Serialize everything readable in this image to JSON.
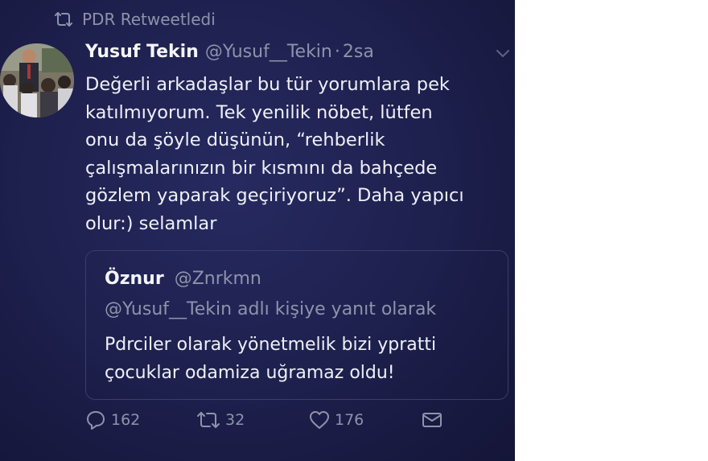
{
  "retweet_context": {
    "icon": "retweet-icon",
    "label": "PDR Retweetledi"
  },
  "author": {
    "name": "Yusuf Tekin",
    "handle": "@Yusuf__Tekin",
    "separator": "·",
    "time": "2sa",
    "avatar": "avatar-photo"
  },
  "tweet_text": "Değerli arkadaşlar bu tür yorumlara pek\nkatılmıyorum. Tek yenilik nöbet, lütfen\nonu da şöyle düşünün, “rehberlik\nçalışmalarınızın bir kısmını da bahçede\ngözlem yaparak geçiriyoruz”. Daha yapıcı\nolur:) selamlar",
  "quoted_tweet": {
    "name": "Öznur",
    "handle": "@Znrkmn",
    "reply_context": "@Yusuf__Tekin adlı kişiye yanıt olarak",
    "text": "Pdrciler olarak yönetmelik bizi ypratti\nçocuklar odamiza uğramaz oldu!"
  },
  "actions": {
    "reply": {
      "icon": "reply-icon",
      "count": "162"
    },
    "retweet": {
      "icon": "retweet-icon",
      "count": "32"
    },
    "like": {
      "icon": "heart-icon",
      "count": "176"
    },
    "message": {
      "icon": "envelope-icon"
    }
  },
  "colors": {
    "background": "#1d1f4c",
    "text": "#eef0f8",
    "muted": "#8e93ab",
    "border": "#3a3e68"
  }
}
